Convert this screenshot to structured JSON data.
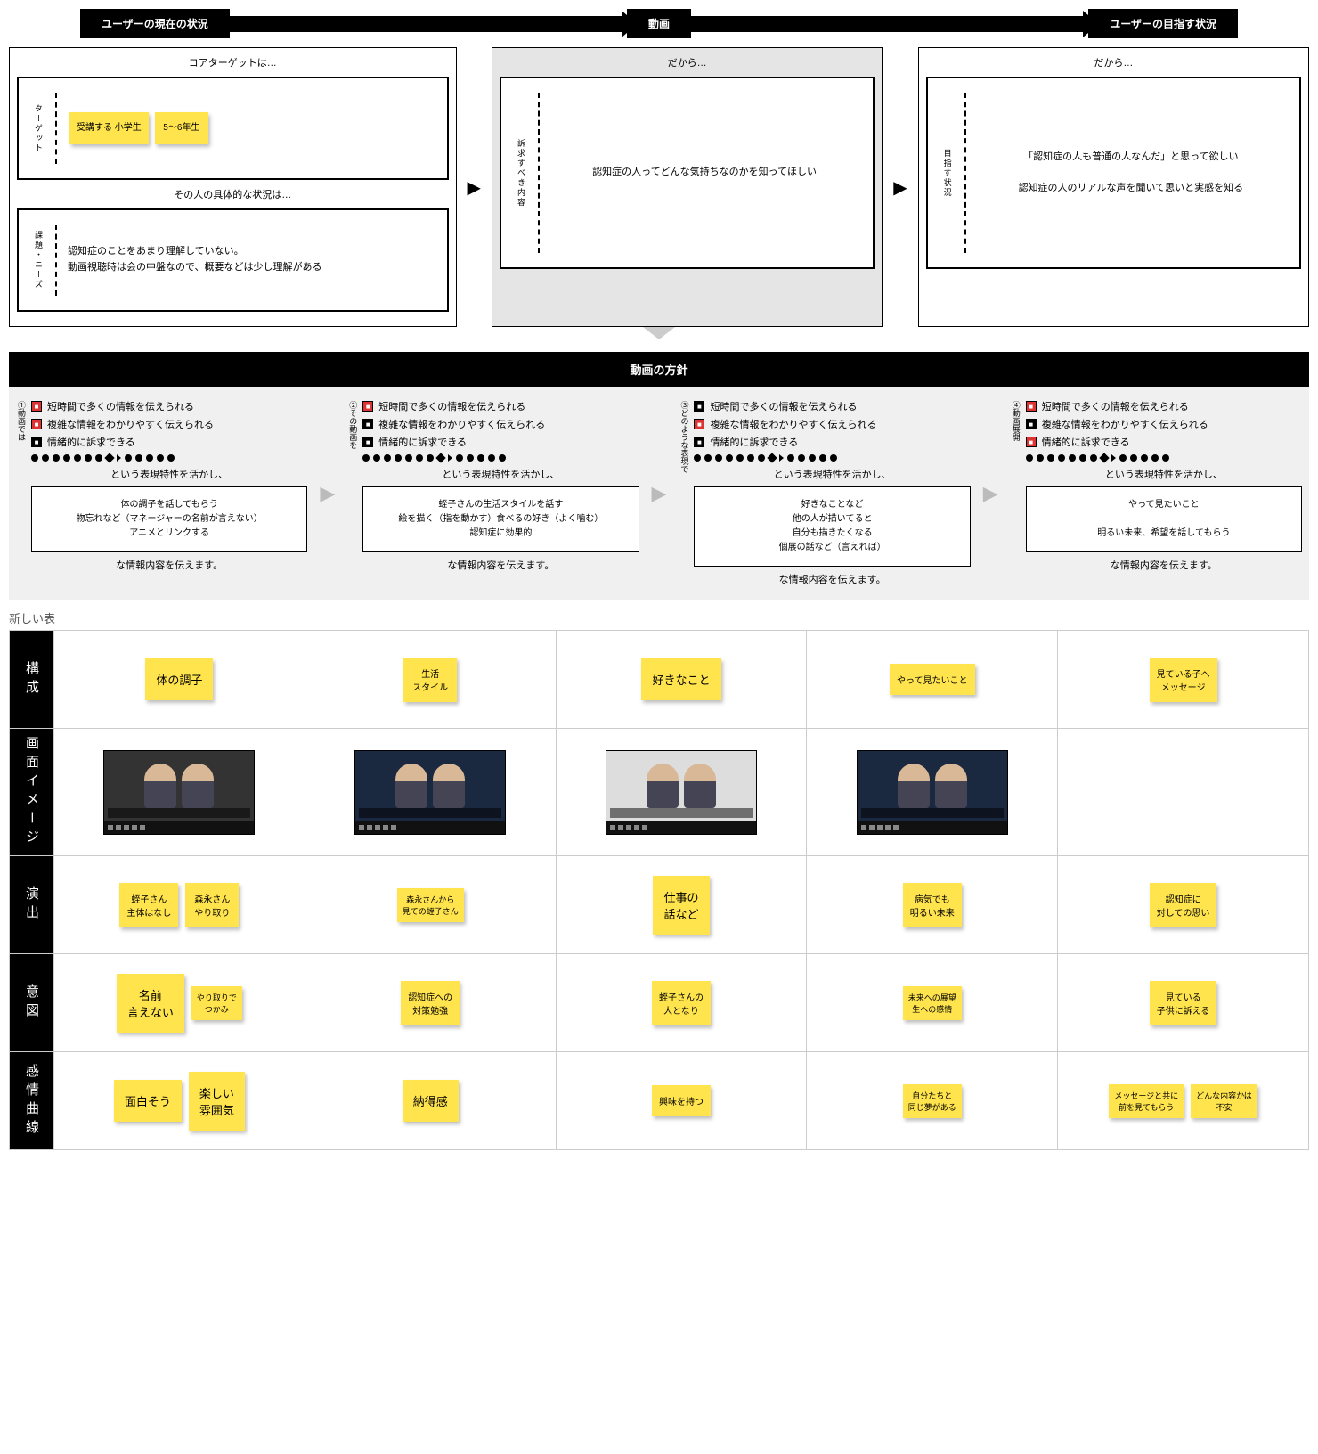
{
  "flow": {
    "left": "ユーザーの現在の状況",
    "center": "動画",
    "right": "ユーザーの目指す状況"
  },
  "panels": {
    "left": {
      "heading1": "コアターゲットは…",
      "target_vlabel": "ターゲット",
      "sticky1": "受講する\n小学生",
      "sticky2": "5〜6年生",
      "heading2": "その人の具体的な状況は…",
      "needs_vlabel": "課題・ニーズ",
      "needs_text": "認知症のことをあまり理解していない。\n動画視聴時は会の中盤なので、概要などは少し理解がある"
    },
    "center": {
      "heading": "だから…",
      "vlabel": "訴求すべき内容",
      "text": "認知症の人ってどんな気持ちなのかを知ってほしい"
    },
    "right": {
      "heading": "だから…",
      "vlabel": "目指す状況",
      "line1": "「認知症の人も普通の人なんだ」と思って欲しい",
      "line2": "認知症の人のリアルな声を聞いて思いと実感を知る"
    }
  },
  "policy_title": "動画の方針",
  "policy_checks": {
    "c1": "短時間で多くの情報を伝えられる",
    "c2": "複雑な情報をわかりやすく伝えられる",
    "c3": "情緒的に訴求できる"
  },
  "policy_common": {
    "exploit": "という表現特性を活かし、",
    "convey": "な情報内容を伝えます。"
  },
  "policy_cols": [
    {
      "vlabel": "①動画では",
      "box": "体の調子を話してもらう\n物忘れなど（マネージャーの名前が言えない）\nアニメとリンクする",
      "checks": [
        true,
        true,
        false
      ]
    },
    {
      "vlabel": "②その動画を",
      "box": "蛭子さんの生活スタイルを話す\n絵を描く（指を動かす）食べるの好き（よく噛む）\n認知症に効果的",
      "checks": [
        true,
        false,
        false
      ]
    },
    {
      "vlabel": "③どのような表現で",
      "box": "好きなことなど\n他の人が描いてると\n自分も描きたくなる\n個展の話など（言えれば）",
      "checks": [
        false,
        true,
        false
      ]
    },
    {
      "vlabel": "④動画展開",
      "box": "やって見たいこと\n\n明るい未来、希望を話してもらう",
      "checks": [
        true,
        false,
        true
      ]
    }
  ],
  "table_title": "新しい表",
  "table": {
    "rows": [
      "構成",
      "画面イメージ",
      "演出",
      "意図",
      "感情曲線"
    ],
    "r1": [
      "体の調子",
      "生活\nスタイル",
      "好きなこと",
      "やって見たいこと",
      "見ている子へ\nメッセージ"
    ],
    "r3": [
      [
        {
          "t": "蛭子さん\n主体はなし"
        },
        {
          "t": "森永さん\nやり取り"
        }
      ],
      [
        {
          "t": "森永さんから\n見ての蛭子さん",
          "sm": true
        }
      ],
      [
        {
          "t": "仕事の\n話など",
          "lg": true
        }
      ],
      [
        {
          "t": "病気でも\n明るい未来"
        }
      ],
      [
        {
          "t": "認知症に\n対しての思い"
        }
      ]
    ],
    "r4": [
      [
        {
          "t": "名前\n言えない",
          "lg": true
        },
        {
          "t": "やり取りで\nつかみ",
          "sm": true
        }
      ],
      [
        {
          "t": "認知症への\n対策勉強"
        }
      ],
      [
        {
          "t": "蛭子さんの\n人となり"
        }
      ],
      [
        {
          "t": "未来への展望\n生への感情",
          "sm": true
        }
      ],
      [
        {
          "t": "見ている\n子供に訴える"
        }
      ]
    ],
    "r5": [
      [
        {
          "t": "面白そう",
          "lg": true
        },
        {
          "t": "楽しい\n雰囲気",
          "lg": true
        }
      ],
      [
        {
          "t": "納得感",
          "lg": true
        }
      ],
      [
        {
          "t": "興味を持つ"
        }
      ],
      [
        {
          "t": "自分たちと\n同じ夢がある",
          "sm": true
        }
      ],
      [
        {
          "t": "メッセージと共に\n前を見てもらう",
          "sm": true
        },
        {
          "t": "どんな内容かは\n不安",
          "sm": true
        }
      ]
    ]
  }
}
